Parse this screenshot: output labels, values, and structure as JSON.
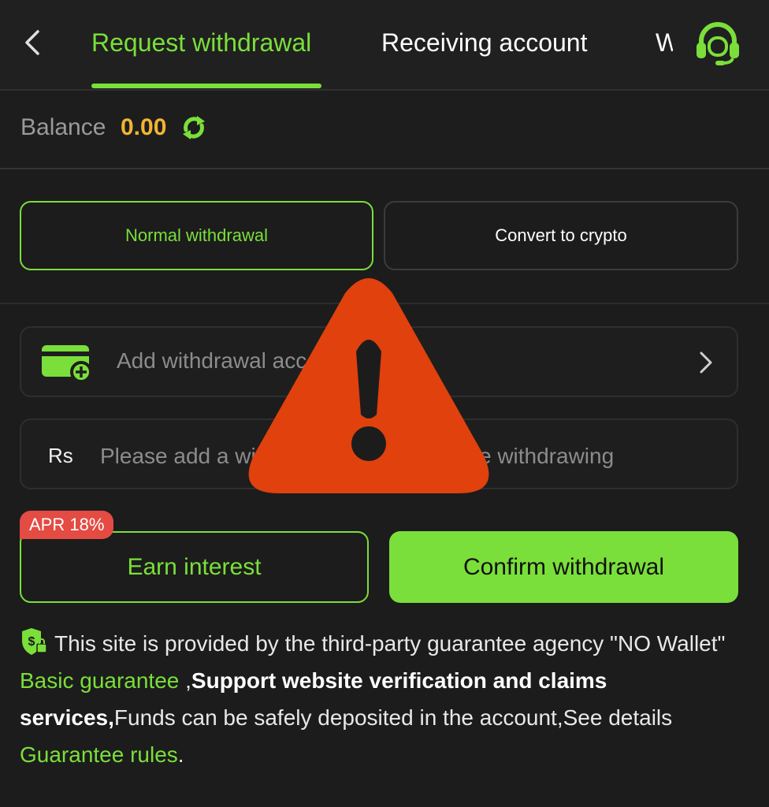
{
  "header": {
    "tabs": [
      {
        "label": "Request withdrawal",
        "active": true
      },
      {
        "label": "Receiving account",
        "active": false
      },
      {
        "label": "W",
        "active": false
      }
    ]
  },
  "balance": {
    "label": "Balance",
    "value": "0.00"
  },
  "modes": {
    "normal_label": "Normal withdrawal",
    "crypto_label": "Convert to crypto",
    "selected": "normal"
  },
  "account_field": {
    "label": "Add withdrawal account"
  },
  "amount_field": {
    "currency": "Rs",
    "placeholder": "Please add a withdrawal account before withdrawing",
    "value": ""
  },
  "actions": {
    "apr_badge": "APR 18%",
    "earn_label": "Earn interest",
    "confirm_label": "Confirm withdrawal"
  },
  "notice": {
    "text_1": "This site is provided by the third-party guarantee agency \"NO Wallet\" ",
    "basic_guarantee": "Basic guarantee",
    "text_2": " ,",
    "bold_text": "Support website verification and claims services,",
    "text_3": "Funds can be safely deposited in the account,See details ",
    "rules_link": "Guarantee rules",
    "text_4": "."
  },
  "icons": {
    "back": "chevron-left-icon",
    "support": "headset-icon",
    "refresh": "refresh-icon",
    "wallet": "wallet-add-icon",
    "chevron": "chevron-right-icon",
    "shield": "shield-dollar-lock-icon",
    "overlay": "warning-triangle-icon"
  },
  "colors": {
    "accent": "#7adf3a",
    "balance": "#f2b531",
    "badge": "#e34b43",
    "warning": "#e0410d",
    "background": "#1c1c1c"
  }
}
